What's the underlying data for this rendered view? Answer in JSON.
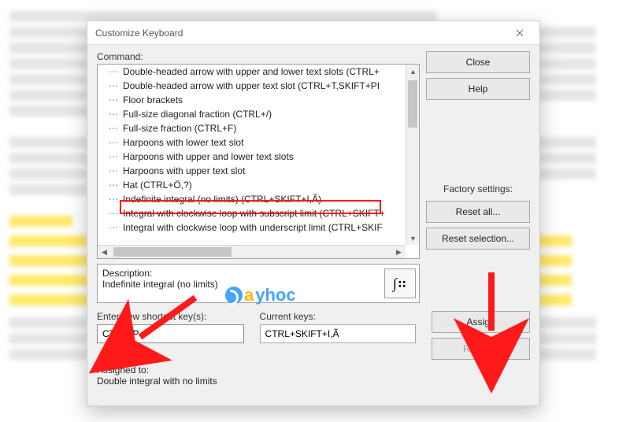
{
  "dialog": {
    "title": "Customize Keyboard",
    "command_label": "Command:",
    "items": [
      "Double-headed arrow with upper and lower text slots (CTRL+",
      "Double-headed arrow with upper text slot (CTRL+T,SKIFT+PI",
      "Floor brackets",
      "Full-size diagonal fraction (CTRL+/)",
      "Full-size fraction (CTRL+F)",
      "Harpoons with lower text slot",
      "Harpoons with upper and lower text slots",
      "Harpoons with upper text slot",
      "Hat (CTRL+Ö,?)",
      "Indefinite integral (no limits) (CTRL+SKIFT+I,Ã)",
      "Integral with clockwise loop with subscript limit (CTRL+SKIFT+",
      "Integral with clockwise loop with underscript limit (CTRL+SKIF"
    ],
    "description_label": "Description:",
    "description_value": "Indefinite integral (no limits)",
    "preview_glyph": "∫⠶",
    "enter_label": "Enter new shortcut key(s):",
    "enter_value": "CTRL+P",
    "current_label": "Current keys:",
    "current_value": "CTRL+SKIFT+I,Ã",
    "assigned_label": "Assigned to:",
    "assigned_value": "Double integral with no limits",
    "factory_label": "Factory settings:"
  },
  "buttons": {
    "close": "Close",
    "help": "Help",
    "reset_all": "Reset all...",
    "reset_selection": "Reset selection...",
    "assign": "Assign",
    "remove": "Remove"
  },
  "watermark": {
    "a": "a",
    "rest": "yhoc"
  }
}
